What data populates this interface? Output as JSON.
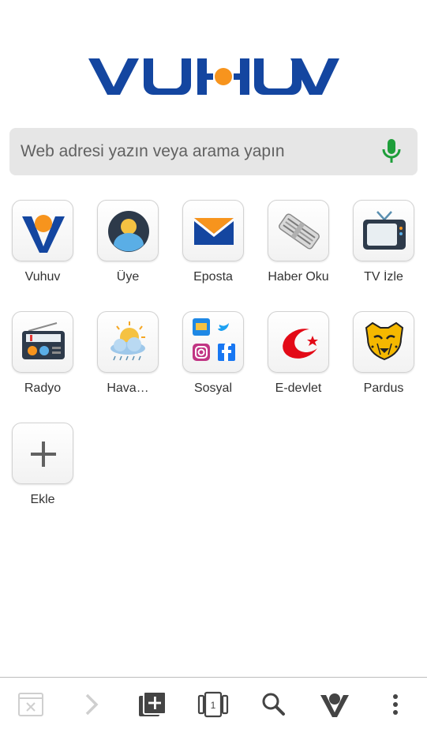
{
  "brand": {
    "name": "Vuhuv",
    "logo_color": "#1446a0",
    "accent_color": "#f7941d"
  },
  "search": {
    "placeholder": "Web adresi yazın veya arama yapın",
    "mic_icon": "microphone-icon",
    "mic_color": "#1e9e3a"
  },
  "shortcuts": [
    {
      "label": "Vuhuv",
      "icon": "vuhuv-logo-icon"
    },
    {
      "label": "Üye",
      "icon": "user-avatar-icon"
    },
    {
      "label": "Eposta",
      "icon": "envelope-icon"
    },
    {
      "label": "Haber Oku",
      "icon": "newspaper-icon"
    },
    {
      "label": "TV İzle",
      "icon": "television-icon"
    },
    {
      "label": "Radyo",
      "icon": "radio-icon"
    },
    {
      "label": "Hava…",
      "icon": "weather-icon"
    },
    {
      "label": "Sosyal",
      "icon": "social-apps-icon"
    },
    {
      "label": "E-devlet",
      "icon": "edevlet-icon"
    },
    {
      "label": "Pardus",
      "icon": "pardus-cheetah-icon"
    },
    {
      "label": "Ekle",
      "icon": "plus-icon"
    }
  ],
  "bottom_bar": {
    "tab_counter": "1",
    "icons": [
      "close-tab-icon",
      "forward-icon",
      "new-tab-icon",
      "tab-switcher-icon",
      "search-icon",
      "vuhuv-home-icon",
      "more-menu-icon"
    ]
  }
}
